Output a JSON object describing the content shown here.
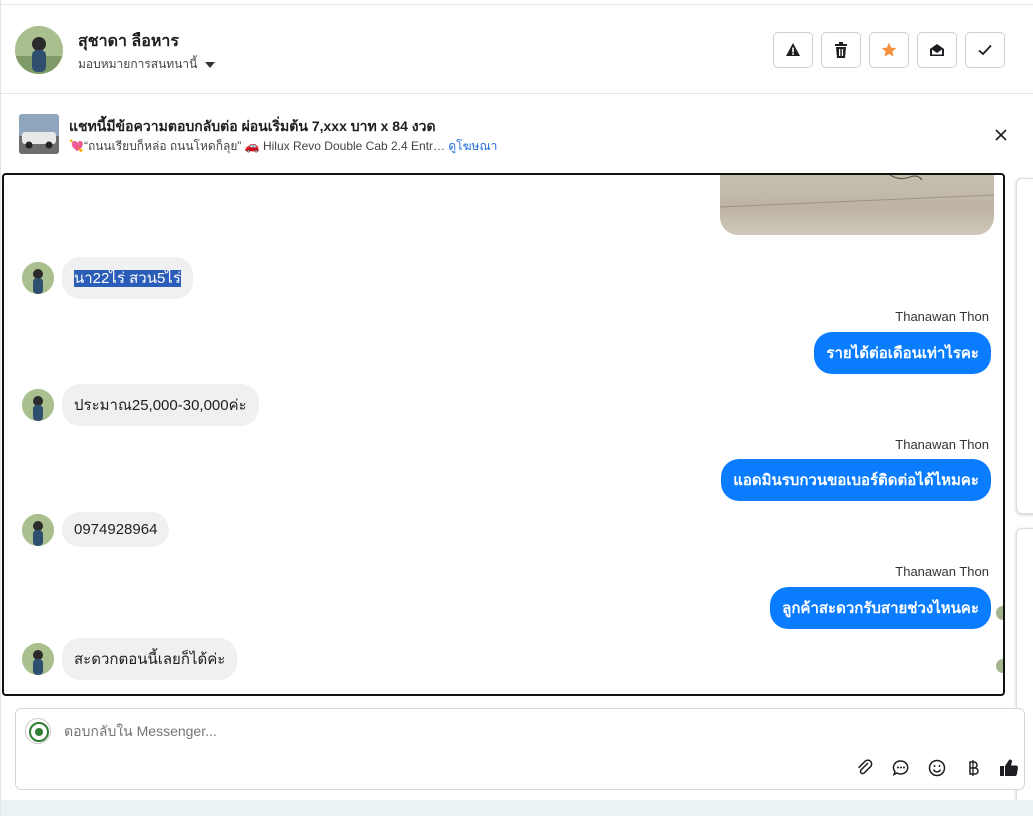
{
  "header": {
    "contact_name": "สุชาดา ลือหาร",
    "assign_label": "มอบหมายการสนทนานี้",
    "actions": [
      "spam-icon",
      "trash-icon",
      "star-icon",
      "mark-unread-icon",
      "done-icon"
    ],
    "star_color": "#f5913e"
  },
  "ad": {
    "title": "แชทนี้มีข้อความตอบกลับต่อ ผ่อนเริ่มต้น 7,xxx บาท x 84 งวด",
    "subtitle": "💘“ถนนเรียบก็หล่อ ถนนโหดก็ลุย” 🚗 Hilux Revo Double Cab 2.4 Entr…",
    "link": "ดูโฆษณา"
  },
  "messages": {
    "m1": "นา22ไร่ สวน5ไร่",
    "s1": "Thanawan Thon",
    "m2": "รายได้ต่อเดือนเท่าไรคะ",
    "m3": "ประมาณ25,000-30,000ค่ะ",
    "s2": "Thanawan Thon",
    "m4": "แอดมินรบกวนขอเบอร์ติดต่อได้ไหมคะ",
    "m5": "0974928964",
    "s3": "Thanawan Thon",
    "m6": "ลูกค้าสะดวกรับสายช่วงไหนคะ",
    "m7": "สะดวกตอนนี้เลยก็ได้ค่ะ"
  },
  "composer": {
    "placeholder": "ตอบกลับใน Messenger...",
    "tools": [
      "attach-icon",
      "saved-reply-icon",
      "emoji-icon",
      "baht-icon",
      "like-icon"
    ]
  },
  "colors": {
    "outgoing": "#0a7cff",
    "incoming": "#f0f0f0",
    "link": "#216fdb"
  }
}
